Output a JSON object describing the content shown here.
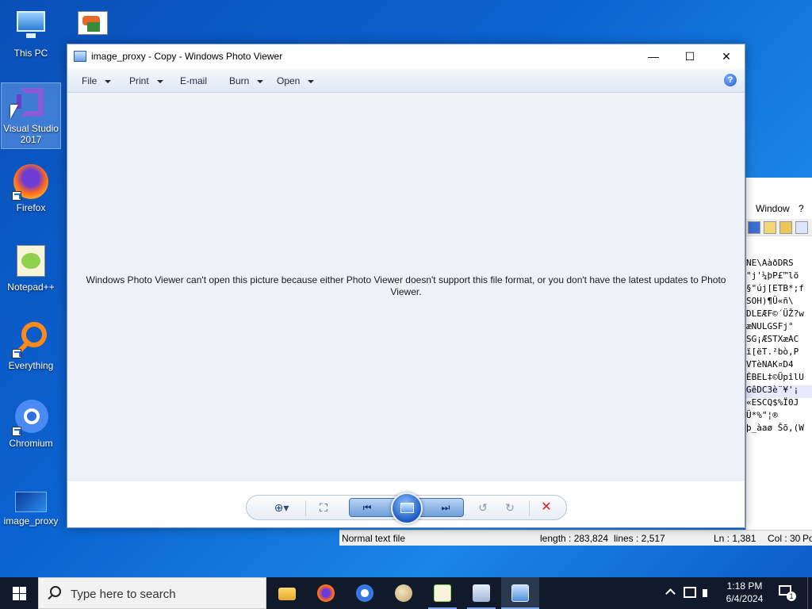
{
  "desktop": {
    "icons": [
      {
        "label": "This PC"
      },
      {
        "label": "Visual Studio 2017"
      },
      {
        "label": "Firefox"
      },
      {
        "label": "Notepad++"
      },
      {
        "label": "Everything"
      },
      {
        "label": "Chromium"
      },
      {
        "label": "image_proxy"
      }
    ]
  },
  "viewer": {
    "title": "image_proxy - Copy - Windows Photo Viewer",
    "menu": {
      "file": "File",
      "print": "Print",
      "email": "E-mail",
      "burn": "Burn",
      "open": "Open",
      "help": "?"
    },
    "window_buttons": {
      "minimize": "—",
      "maximize": "☐",
      "close": "✕"
    },
    "error_message": "Windows Photo Viewer can't open this picture because either Photo Viewer doesn't support this file format, or you don't have the latest updates to Photo Viewer.",
    "controls": {
      "zoom": "⊕▾",
      "fit": "⛶",
      "previous": "⏮",
      "next": "⏭",
      "rotate_ccw": "↺",
      "rotate_cw": "↻",
      "delete": "✕"
    }
  },
  "notepadpp": {
    "menu_window": "Window",
    "menu_help": "?",
    "code_lines": [
      "NE\\AàðDRS",
      "\"j'¼þP£™lõ",
      "§\"új[ETB*;f",
      "",
      "SOH)¶Ü«ñ\\",
      "DLEÆF©´ÜŽ?w",
      "æNULGSFj°",
      "SG¡ÆSTXæAC",
      "",
      "",
      "ï[ëT.²bò,P",
      "VTèNAK¤D4",
      "ÉBEL‡©ÜpîlU",
      "GêDC3è¨¥'¡",
      "«ESCQ$%Ï0J",
      "Ü*%\"¦®",
      "þ_àaø Šõ,(W"
    ],
    "status": {
      "file_type": "Normal text file",
      "length": "length : 283,824",
      "lines": "lines : 2,517",
      "ln": "Ln : 1,381",
      "col": "Col : 30",
      "pos": "Po"
    }
  },
  "taskbar": {
    "search_placeholder": "Type here to search",
    "time": "1:18 PM",
    "date": "6/4/2024",
    "notification_count": "1"
  },
  "colors": {
    "desktop_bg": "#0b63d1",
    "taskbar_bg": "#101a2b",
    "viewer_bg": "#eef2f8",
    "delete_red": "#d42020"
  }
}
